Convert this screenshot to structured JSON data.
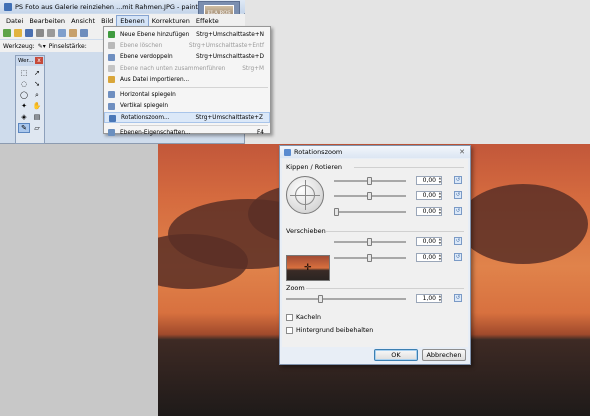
{
  "app": {
    "title": "PS Foto aus Galerie reinziehen ...mit Rahmen.JPG - paint.net v4.0.9",
    "thumb_text": "ELA ROS"
  },
  "menu": [
    "Datei",
    "Bearbeiten",
    "Ansicht",
    "Bild",
    "Ebenen",
    "Korrekturen",
    "Effekte"
  ],
  "toolbar2": {
    "tool_label": "Werkzeug:",
    "brush_label": "Pinselstärke:"
  },
  "tools_window": {
    "title": "Wer...",
    "close": "x"
  },
  "layers_menu": {
    "items": [
      {
        "label": "Neue Ebene hinzufügen",
        "shortcut": "Strg+Umschalttaste+N",
        "disabled": false,
        "icon_color": "#3f9b3f"
      },
      {
        "label": "Ebene löschen",
        "shortcut": "Strg+Umschalttaste+Entf",
        "disabled": true,
        "icon_color": "#b9b9b9"
      },
      {
        "label": "Ebene verdoppeln",
        "shortcut": "Strg+Umschalttaste+D",
        "disabled": false,
        "icon_color": "#6f8fc0"
      },
      {
        "label": "Ebene nach unten zusammenführen",
        "shortcut": "Strg+M",
        "disabled": true,
        "icon_color": "#c4c4c4"
      },
      {
        "label": "Aus Datei importieren...",
        "shortcut": "",
        "disabled": false,
        "icon_color": "#d9a63a"
      },
      {
        "label": "Horizontal spiegeln",
        "shortcut": "",
        "disabled": false,
        "icon_color": "#6f8fc0"
      },
      {
        "label": "Vertikal spiegeln",
        "shortcut": "",
        "disabled": false,
        "icon_color": "#6f8fc0"
      },
      {
        "label": "Rotationszoom...",
        "shortcut": "Strg+Umschalttaste+Z",
        "disabled": false,
        "icon_color": "#4a78b8",
        "highlighted": true
      },
      {
        "label": "Ebenen-Eigenschaften...",
        "shortcut": "F4",
        "disabled": false,
        "icon_color": "#6a8fbf"
      }
    ]
  },
  "dialog": {
    "title": "Rotationszoom",
    "close": "✕",
    "section_tilt": "Kippen / Rotieren",
    "section_pan": "Verschieben",
    "section_zoom": "Zoom",
    "tilt_values": [
      "0,00",
      "0,00",
      "0,00"
    ],
    "pan_values": [
      "0,00",
      "0,00"
    ],
    "zoom_value": "1,00",
    "tile_label": "Kacheln",
    "keep_bg_label": "Hintergrund beibehalten",
    "ok": "OK",
    "cancel": "Abbrechen",
    "colors": {
      "accent": "#3c7fb1"
    }
  }
}
